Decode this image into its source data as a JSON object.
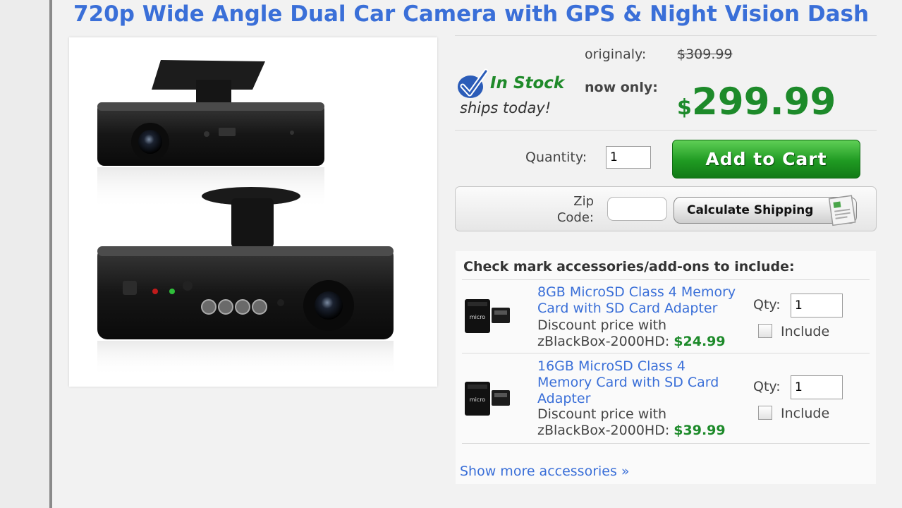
{
  "product": {
    "title": "720p Wide Angle Dual Car Camera with GPS & Night Vision Dash",
    "image_icon": "dual-dash-camera-product-photo"
  },
  "stock": {
    "status": "In Stock",
    "shipping_note": "ships today!"
  },
  "pricing": {
    "original_label": "originaly:",
    "original_price": "$309.99",
    "now_label": "now only:",
    "currency": "$",
    "now_price": "299.99"
  },
  "cart": {
    "quantity_label": "Quantity:",
    "quantity_value": "1",
    "add_to_cart_label": "Add to Cart"
  },
  "shipping": {
    "zip_label_line1": "Zip",
    "zip_label_line2": "Code:",
    "zip_value": "",
    "calculate_label": "Calculate Shipping"
  },
  "accessories": {
    "header": "Check mark accessories/add-ons to include:",
    "items": [
      {
        "name_line1": "8GB MicroSD Class 4 Memory",
        "name_line2": "Card with SD Card Adapter",
        "name_line3": "",
        "desc_line1": "Discount price with",
        "desc_line2": "zBlackBox-2000HD:",
        "price": "$24.99",
        "qty_label": "Qty:",
        "qty_value": "1",
        "include_label": "Include"
      },
      {
        "name_line1": "16GB MicroSD Class 4",
        "name_line2": "Memory Card with SD Card",
        "name_line3": "Adapter",
        "desc_line1": "Discount price with",
        "desc_line2": "zBlackBox-2000HD:",
        "price": "$39.99",
        "qty_label": "Qty:",
        "qty_value": "1",
        "include_label": "Include"
      }
    ],
    "show_more": "Show more accessories »"
  },
  "colors": {
    "link_blue": "#3a6fd8",
    "price_green": "#1d8a2a",
    "cart_button_green": "#1f9a22"
  }
}
